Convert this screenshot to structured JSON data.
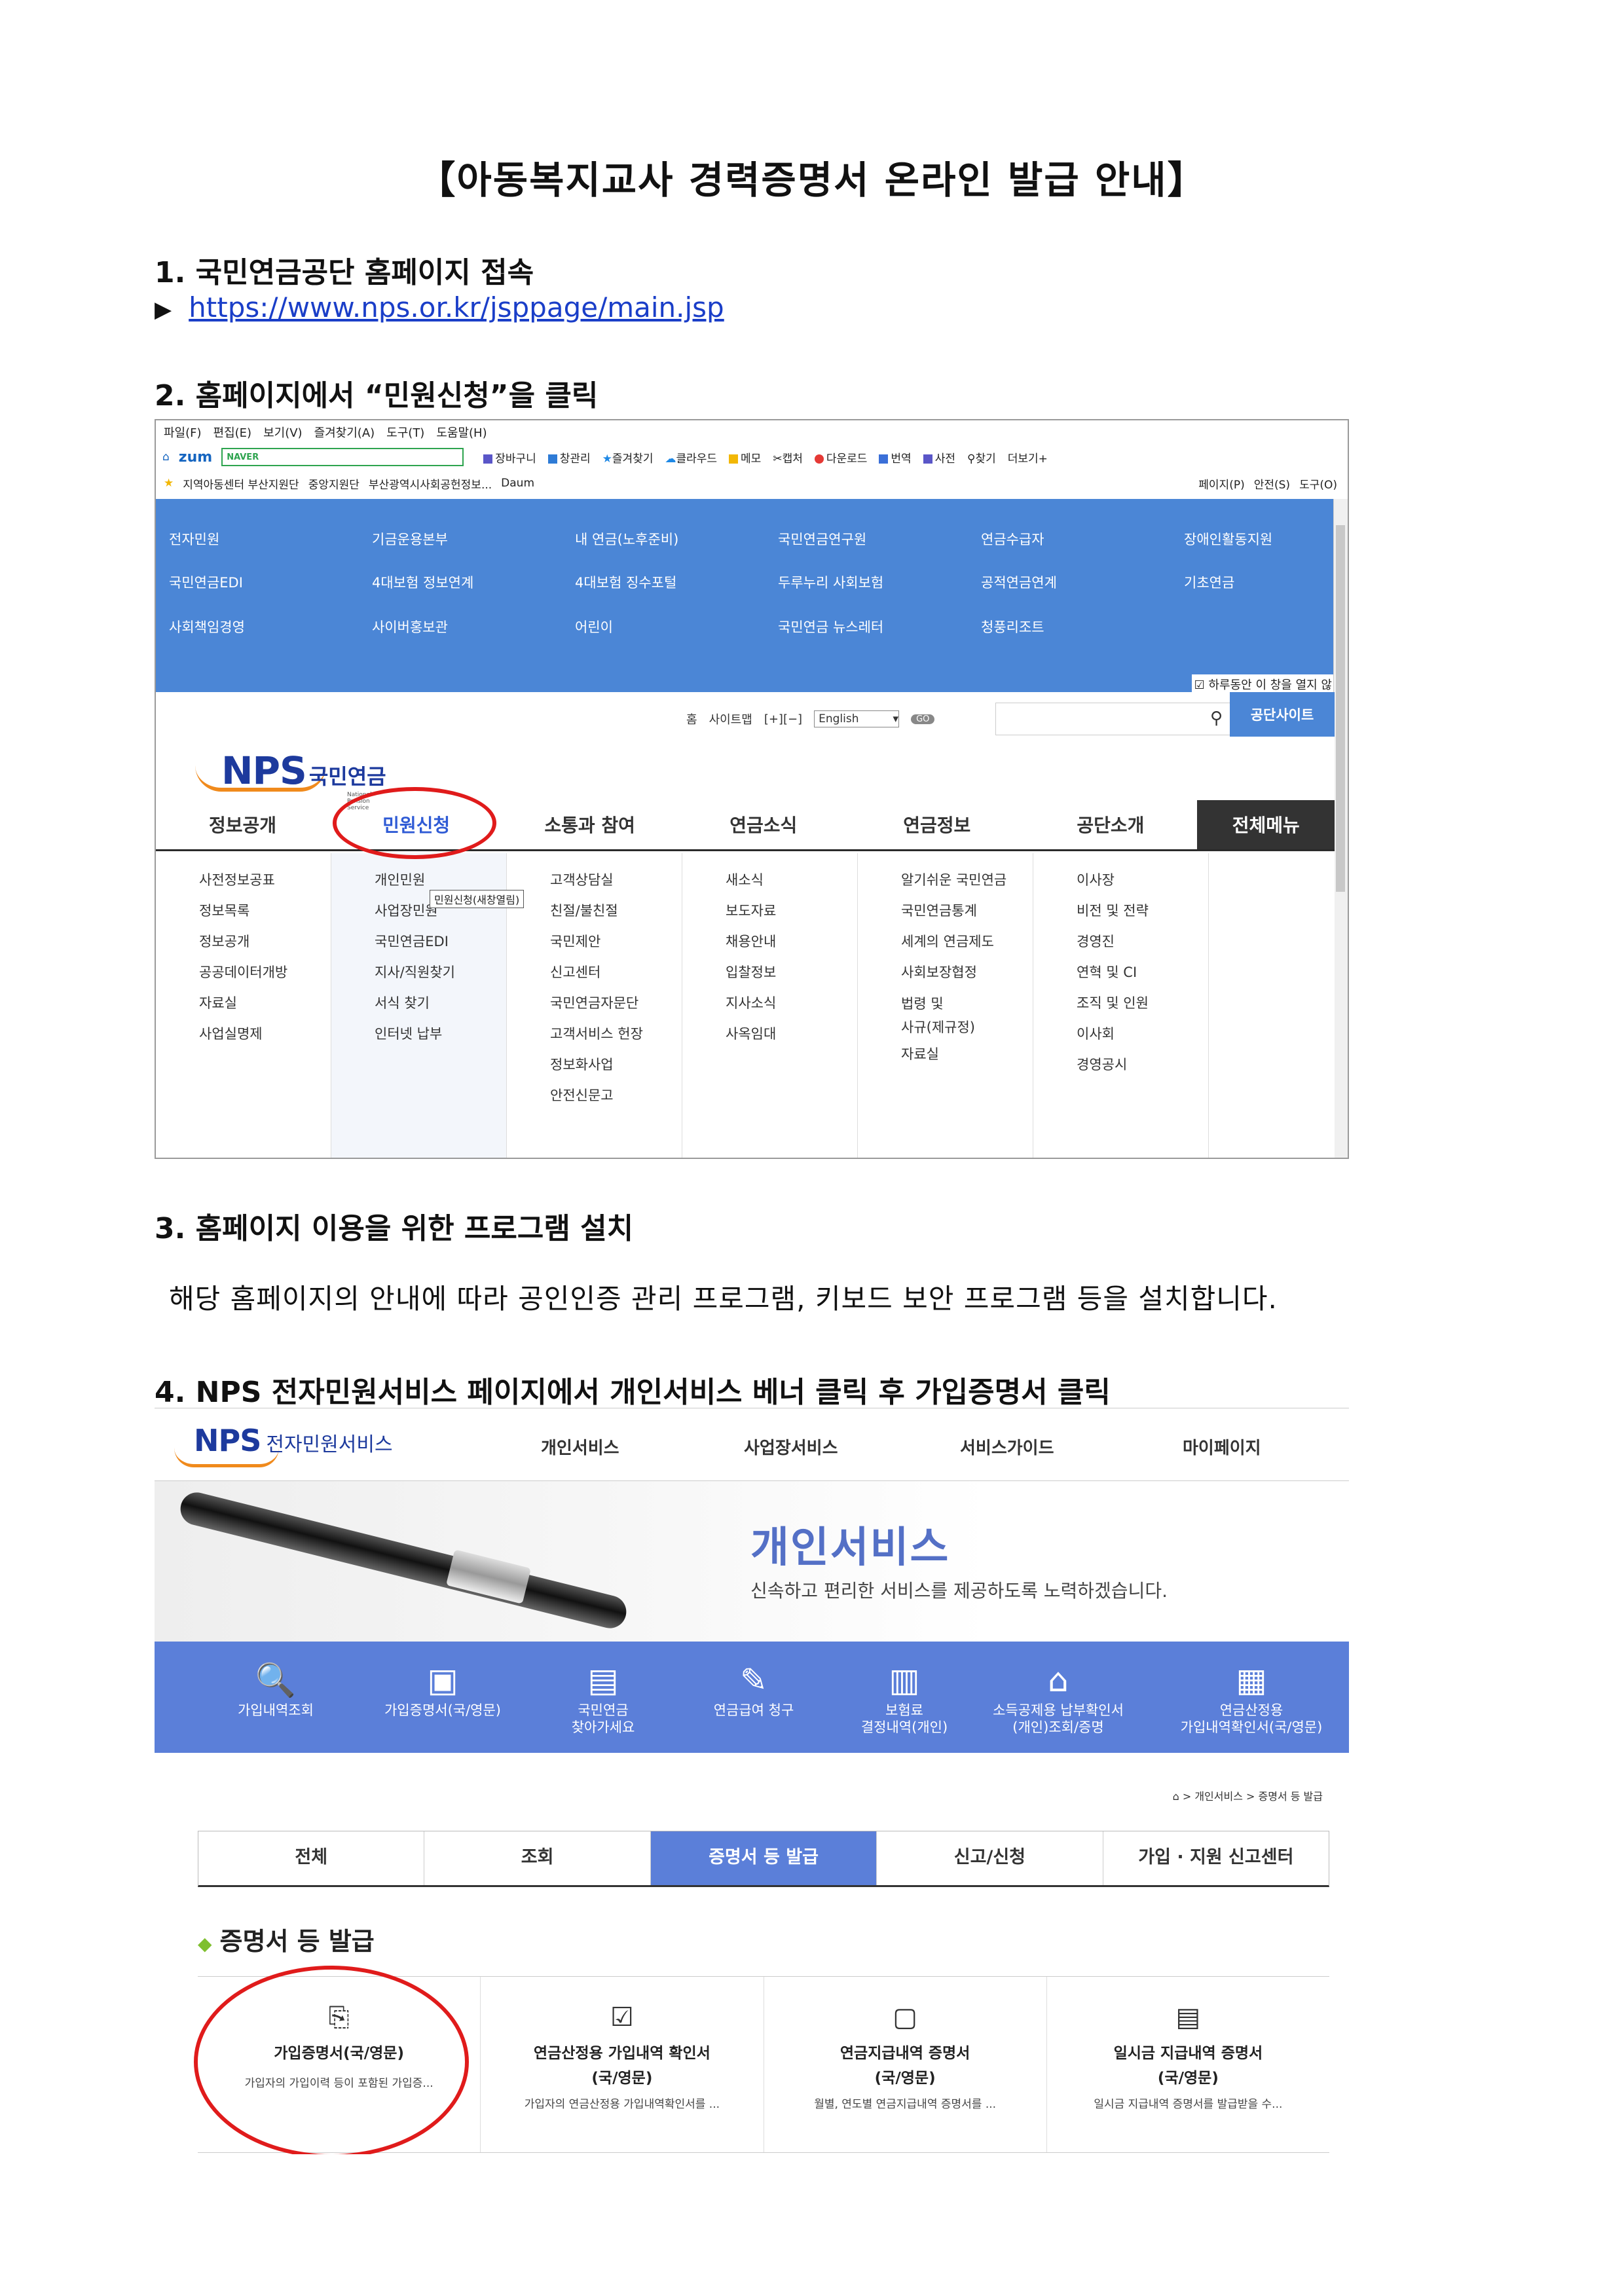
{
  "title": "【아동복지교사 경력증명서 온라인 발급 안내】",
  "steps": {
    "s1": "1. 국민연금공단 홈페이지 접속",
    "link_arrow": "▶",
    "link": "https://www.nps.or.kr/jsppage/main.jsp",
    "s2": "2. 홈페이지에서 “민원신청”을 클릭",
    "s3": "3. 홈페이지 이용을 위한 프로그램 설치",
    "s3_body": "해당 홈페이지의 안내에 따라 공인인증 관리 프로그램, 키보드 보안 프로그램 등을 설치합니다.",
    "s4": "4. NPS 전자민원서비스 페이지에서 개인서비스 베너 클릭 후 가입증명서 클릭"
  },
  "browser": {
    "menubar": [
      "파일(F)",
      "편집(E)",
      "보기(V)",
      "즐겨찾기(A)",
      "도구(T)",
      "도움말(H)"
    ],
    "zum": "zum",
    "naver": "NAVER",
    "tools": [
      "장바구니",
      "창관리",
      "즐겨찾기",
      "클라우드",
      "메모",
      "캡처",
      "다운로드",
      "번역",
      "사전",
      "찾기",
      "더보기+"
    ],
    "favorites": [
      "지역아동센터 부산지원단",
      "중앙지원단",
      "부산광역시사회공헌정보...",
      "Daum"
    ],
    "right_tools": [
      "페이지(P)",
      "안전(S)",
      "도구(O)"
    ]
  },
  "nps_site": {
    "blue_menu": [
      [
        "전자민원",
        "기금운용본부",
        "내 연금(노후준비)",
        "국민연금연구원",
        "연금수급자",
        "장애인활동지원"
      ],
      [
        "국민연금EDI",
        "4대보험 정보연계",
        "4대보험 징수포털",
        "두루누리 사회보험",
        "공적연금연계",
        "기초연금"
      ],
      [
        "사회책임경영",
        "사이버홍보관",
        "어린이",
        "국민연금 뉴스레터",
        "청풍리조트",
        ""
      ]
    ],
    "checkbox_text": "하루동안 이 창을 열지 않",
    "logo": "NPS",
    "logo_kr": "국민연금",
    "logo_sub": "National Pension Service",
    "util": [
      "홈",
      "사이트맵"
    ],
    "lang": "English",
    "go": "GO",
    "gongdan_site": "공단사이트",
    "gnb": [
      "정보공개",
      "민원신청",
      "소통과 참여",
      "연금소식",
      "연금정보",
      "공단소개"
    ],
    "gnb_all": "전체메뉴",
    "tooltip": "민원신청(새창열림)",
    "submenus": [
      [
        "사전정보공표",
        "정보목록",
        "정보공개",
        "공공데이터개방",
        "자료실",
        "사업실명제"
      ],
      [
        "개인민원",
        "사업장민원",
        "국민연금EDI",
        "지사/직원찾기",
        "서식 찾기",
        "인터넷 납부"
      ],
      [
        "고객상담실",
        "친절/불친절",
        "국민제안",
        "신고센터",
        "국민연금자문단",
        "고객서비스 헌장",
        "정보화사업",
        "안전신문고"
      ],
      [
        "새소식",
        "보도자료",
        "채용안내",
        "입찰정보",
        "지사소식",
        "사옥임대"
      ],
      [
        "알기쉬운 국민연금",
        "국민연금통계",
        "세계의 연금제도",
        "사회보장협정",
        "법령 및",
        "사규(제규정)",
        "자료실"
      ],
      [
        "이사장",
        "비전 및 전략",
        "경영진",
        "연혁 및 CI",
        "조직 및 인원",
        "이사회",
        "경영공시"
      ]
    ]
  },
  "eservice": {
    "logo": "NPS",
    "logo_kr": "전자민원서비스",
    "nav": [
      "개인서비스",
      "사업장서비스",
      "서비스가이드",
      "마이페이지"
    ],
    "banner_title": "개인서비스",
    "banner_sub": "신속하고 편리한 서비스를 제공하도록 노력하겠습니다.",
    "services": [
      {
        "icon": "magnifier-icon",
        "l1": "가입내역조회",
        "l2": ""
      },
      {
        "icon": "certificate-icon",
        "l1": "가입증명서(국/영문)",
        "l2": ""
      },
      {
        "icon": "document-icon",
        "l1": "국민연금",
        "l2": "찾아가세요"
      },
      {
        "icon": "pen-document-icon",
        "l1": "연금급여 청구",
        "l2": ""
      },
      {
        "icon": "chart-icon",
        "l1": "보험료",
        "l2": "결정내역(개인)"
      },
      {
        "icon": "house-icon",
        "l1": "소득공제용 납부확인서",
        "l2": "(개인)조회/증명"
      },
      {
        "icon": "search-document-icon",
        "l1": "연금산정용",
        "l2": "가입내역확인서(국/영문)"
      }
    ],
    "breadcrumb": "> 개인서비스 > 증명서 등 발급",
    "tabs": [
      "전체",
      "조회",
      "증명서 등 발급",
      "신고/신청",
      "가입 · 지원 신고센터"
    ],
    "section_title": "증명서 등 발급",
    "cards": [
      {
        "t1": "가입증명서(국/영문)",
        "t2": "",
        "d": "가입자의 가입이력 등이 포함된 가입증..."
      },
      {
        "t1": "연금산정용 가입내역 확인서",
        "t2": "(국/영문)",
        "d": "가입자의 연금산정용 가입내역확인서를 ..."
      },
      {
        "t1": "연금지급내역 증명서",
        "t2": "(국/영문)",
        "d": "월별, 연도별 연금지급내역 증명서를 ..."
      },
      {
        "t1": "일시금 지급내역 증명서",
        "t2": "(국/영문)",
        "d": "일시금 지급내역 증명서를 발급받을 수..."
      }
    ]
  },
  "colors": {
    "nps_blue": "#4b86d6",
    "service_blue": "#5b7fd9",
    "highlight_red": "#e01b1b",
    "logo_orange": "#f08a1c"
  }
}
